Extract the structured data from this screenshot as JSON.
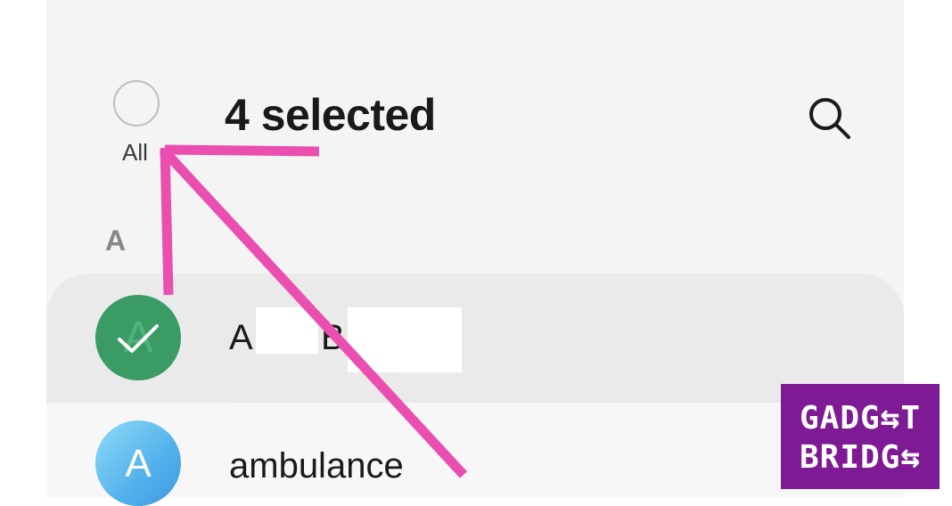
{
  "header": {
    "select_all_label": "All",
    "title": "4 selected"
  },
  "icons": {
    "search": "search-icon",
    "select_all": "circle-checkbox-icon",
    "check": "check-icon"
  },
  "section": {
    "letter": "A"
  },
  "contacts": [
    {
      "avatar_letter": "A",
      "name_parts": [
        "A",
        "B"
      ],
      "selected": true,
      "avatar_color": "#3a9b65"
    },
    {
      "avatar_letter": "A",
      "name": "ambulance",
      "selected": false,
      "avatar_color": "#5ab6ed"
    }
  ],
  "annotation": {
    "color": "#ea4fb0"
  },
  "watermark": {
    "line1": "GADG⇆T",
    "line2": "BRIDG⇆",
    "background": "#7d1a94"
  }
}
